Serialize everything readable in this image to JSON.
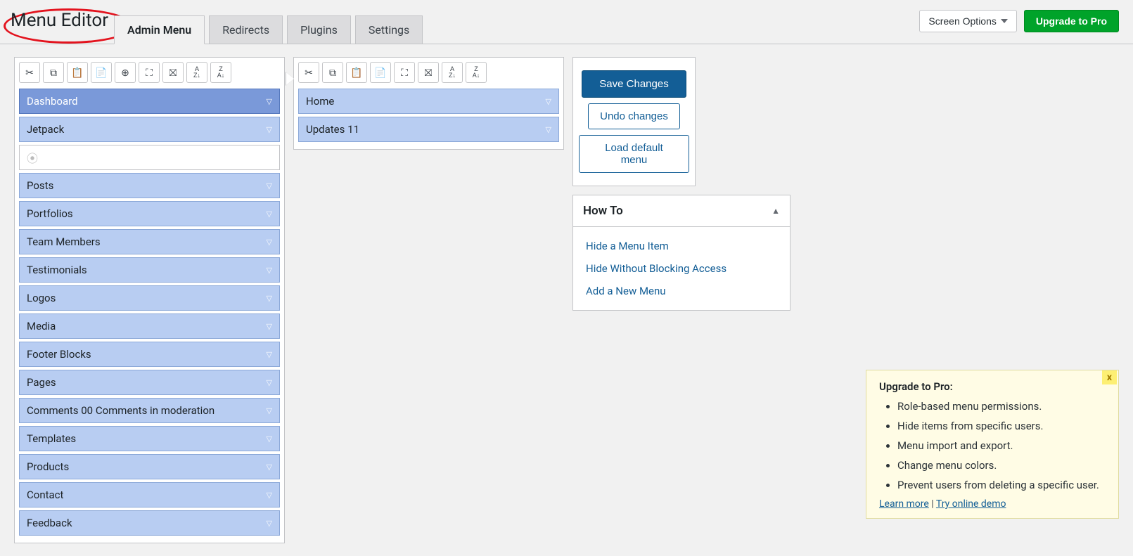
{
  "header": {
    "title": "Menu Editor",
    "tabs": [
      {
        "label": "Admin Menu",
        "active": true
      },
      {
        "label": "Redirects",
        "active": false
      },
      {
        "label": "Plugins",
        "active": false
      },
      {
        "label": "Settings",
        "active": false
      }
    ],
    "screen_options": "Screen Options",
    "upgrade": "Upgrade to Pro"
  },
  "main_menu": {
    "items": [
      {
        "label": "Dashboard",
        "selected": true
      },
      {
        "label": "Jetpack"
      },
      {
        "separator": true
      },
      {
        "label": "Posts"
      },
      {
        "label": "Portfolios"
      },
      {
        "label": "Team Members"
      },
      {
        "label": "Testimonials"
      },
      {
        "label": "Logos"
      },
      {
        "label": "Media"
      },
      {
        "label": "Footer Blocks"
      },
      {
        "label": "Pages"
      },
      {
        "label": "Comments 00 Comments in moderation"
      },
      {
        "label": "Templates"
      },
      {
        "label": "Products"
      },
      {
        "label": "Contact"
      },
      {
        "label": "Feedback"
      }
    ]
  },
  "sub_menu": {
    "items": [
      {
        "label": "Home"
      },
      {
        "label": "Updates 11"
      }
    ]
  },
  "actions": {
    "save": "Save Changes",
    "undo": "Undo changes",
    "load_default": "Load default menu"
  },
  "howto": {
    "title": "How To",
    "links": [
      "Hide a Menu Item",
      "Hide Without Blocking Access",
      "Add a New Menu"
    ]
  },
  "upgrade_box": {
    "title": "Upgrade to Pro:",
    "features": [
      "Role-based menu permissions.",
      "Hide items from specific users.",
      "Menu import and export.",
      "Change menu colors.",
      "Prevent users from deleting a specific user."
    ],
    "learn_more": "Learn more",
    "demo": "Try online demo",
    "sep": " | "
  },
  "toolbar_icons": {
    "cut": "✂",
    "copy": "⧉",
    "paste": "📋",
    "new": "📄",
    "new_sep": "⊕",
    "show": "⛶",
    "delete": "⛝",
    "sort_az": "A↓",
    "sort_za": "Z↓"
  }
}
